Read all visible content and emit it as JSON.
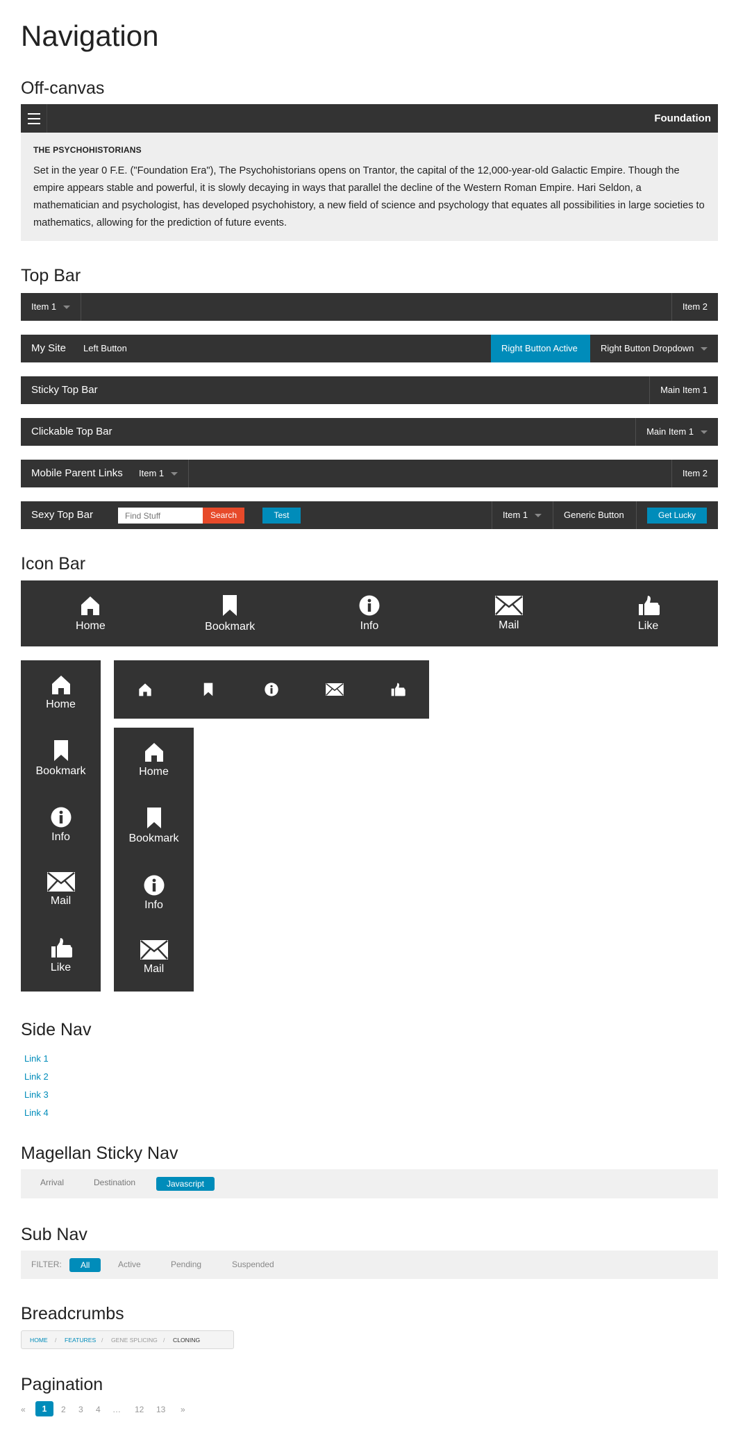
{
  "page_title": "Navigation",
  "offcanvas": {
    "heading": "Off-canvas",
    "bar_title": "Foundation",
    "panel_title": "THE PSYCHOHISTORIANS",
    "panel_text": "Set in the year 0 F.E. (\"Foundation Era\"), The Psychohistorians opens on Trantor, the capital of the 12,000-year-old Galactic Empire. Though the empire appears stable and powerful, it is slowly decaying in ways that parallel the decline of the Western Roman Empire. Hari Seldon, a mathematician and psychologist, has developed psychohistory, a new field of science and psychology that equates all possibilities in large societies to mathematics, allowing for the prediction of future events."
  },
  "topbar": {
    "heading": "Top Bar",
    "bar1": {
      "item1": "Item 1",
      "item2": "Item 2"
    },
    "bar2": {
      "brand": "My Site",
      "left_button": "Left Button",
      "right_active": "Right Button Active",
      "right_dropdown": "Right Button Dropdown"
    },
    "bar3": {
      "brand": "Sticky Top Bar",
      "main_item": "Main Item 1"
    },
    "bar4": {
      "brand": "Clickable Top Bar",
      "main_item": "Main Item 1"
    },
    "bar5": {
      "brand": "Mobile Parent Links",
      "item1": "Item 1",
      "item2": "Item 2"
    },
    "bar6": {
      "brand": "Sexy Top Bar",
      "search_placeholder": "Find Stuff",
      "search_button": "Search",
      "test_button": "Test",
      "item1": "Item 1",
      "generic_button": "Generic Button",
      "lucky_button": "Get Lucky"
    }
  },
  "iconbar": {
    "heading": "Icon Bar",
    "items": [
      "Home",
      "Bookmark",
      "Info",
      "Mail",
      "Like"
    ],
    "icons": [
      "home-icon",
      "bookmark-icon",
      "info-icon",
      "mail-icon",
      "like-icon"
    ]
  },
  "sidenav": {
    "heading": "Side Nav",
    "links": [
      "Link 1",
      "Link 2",
      "Link 3",
      "Link 4"
    ]
  },
  "magellan": {
    "heading": "Magellan Sticky Nav",
    "items": [
      "Arrival",
      "Destination",
      "Javascript"
    ],
    "active": "Javascript"
  },
  "subnav": {
    "heading": "Sub Nav",
    "filter_label": "FILTER:",
    "items": [
      "All",
      "Active",
      "Pending",
      "Suspended"
    ],
    "active": "All"
  },
  "breadcrumbs": {
    "heading": "Breadcrumbs",
    "items": [
      "HOME",
      "FEATURES",
      "GENE SPLICING",
      "CLONING"
    ],
    "separator": "/"
  },
  "pagination": {
    "heading": "Pagination",
    "prev": "«",
    "pages": [
      "1",
      "2",
      "3",
      "4",
      "…",
      "12",
      "13"
    ],
    "current": "1",
    "next": "»"
  },
  "colors": {
    "bar": "#333333",
    "accent": "#008cba",
    "alert": "#e74a2a",
    "panel": "#eeeeee"
  }
}
